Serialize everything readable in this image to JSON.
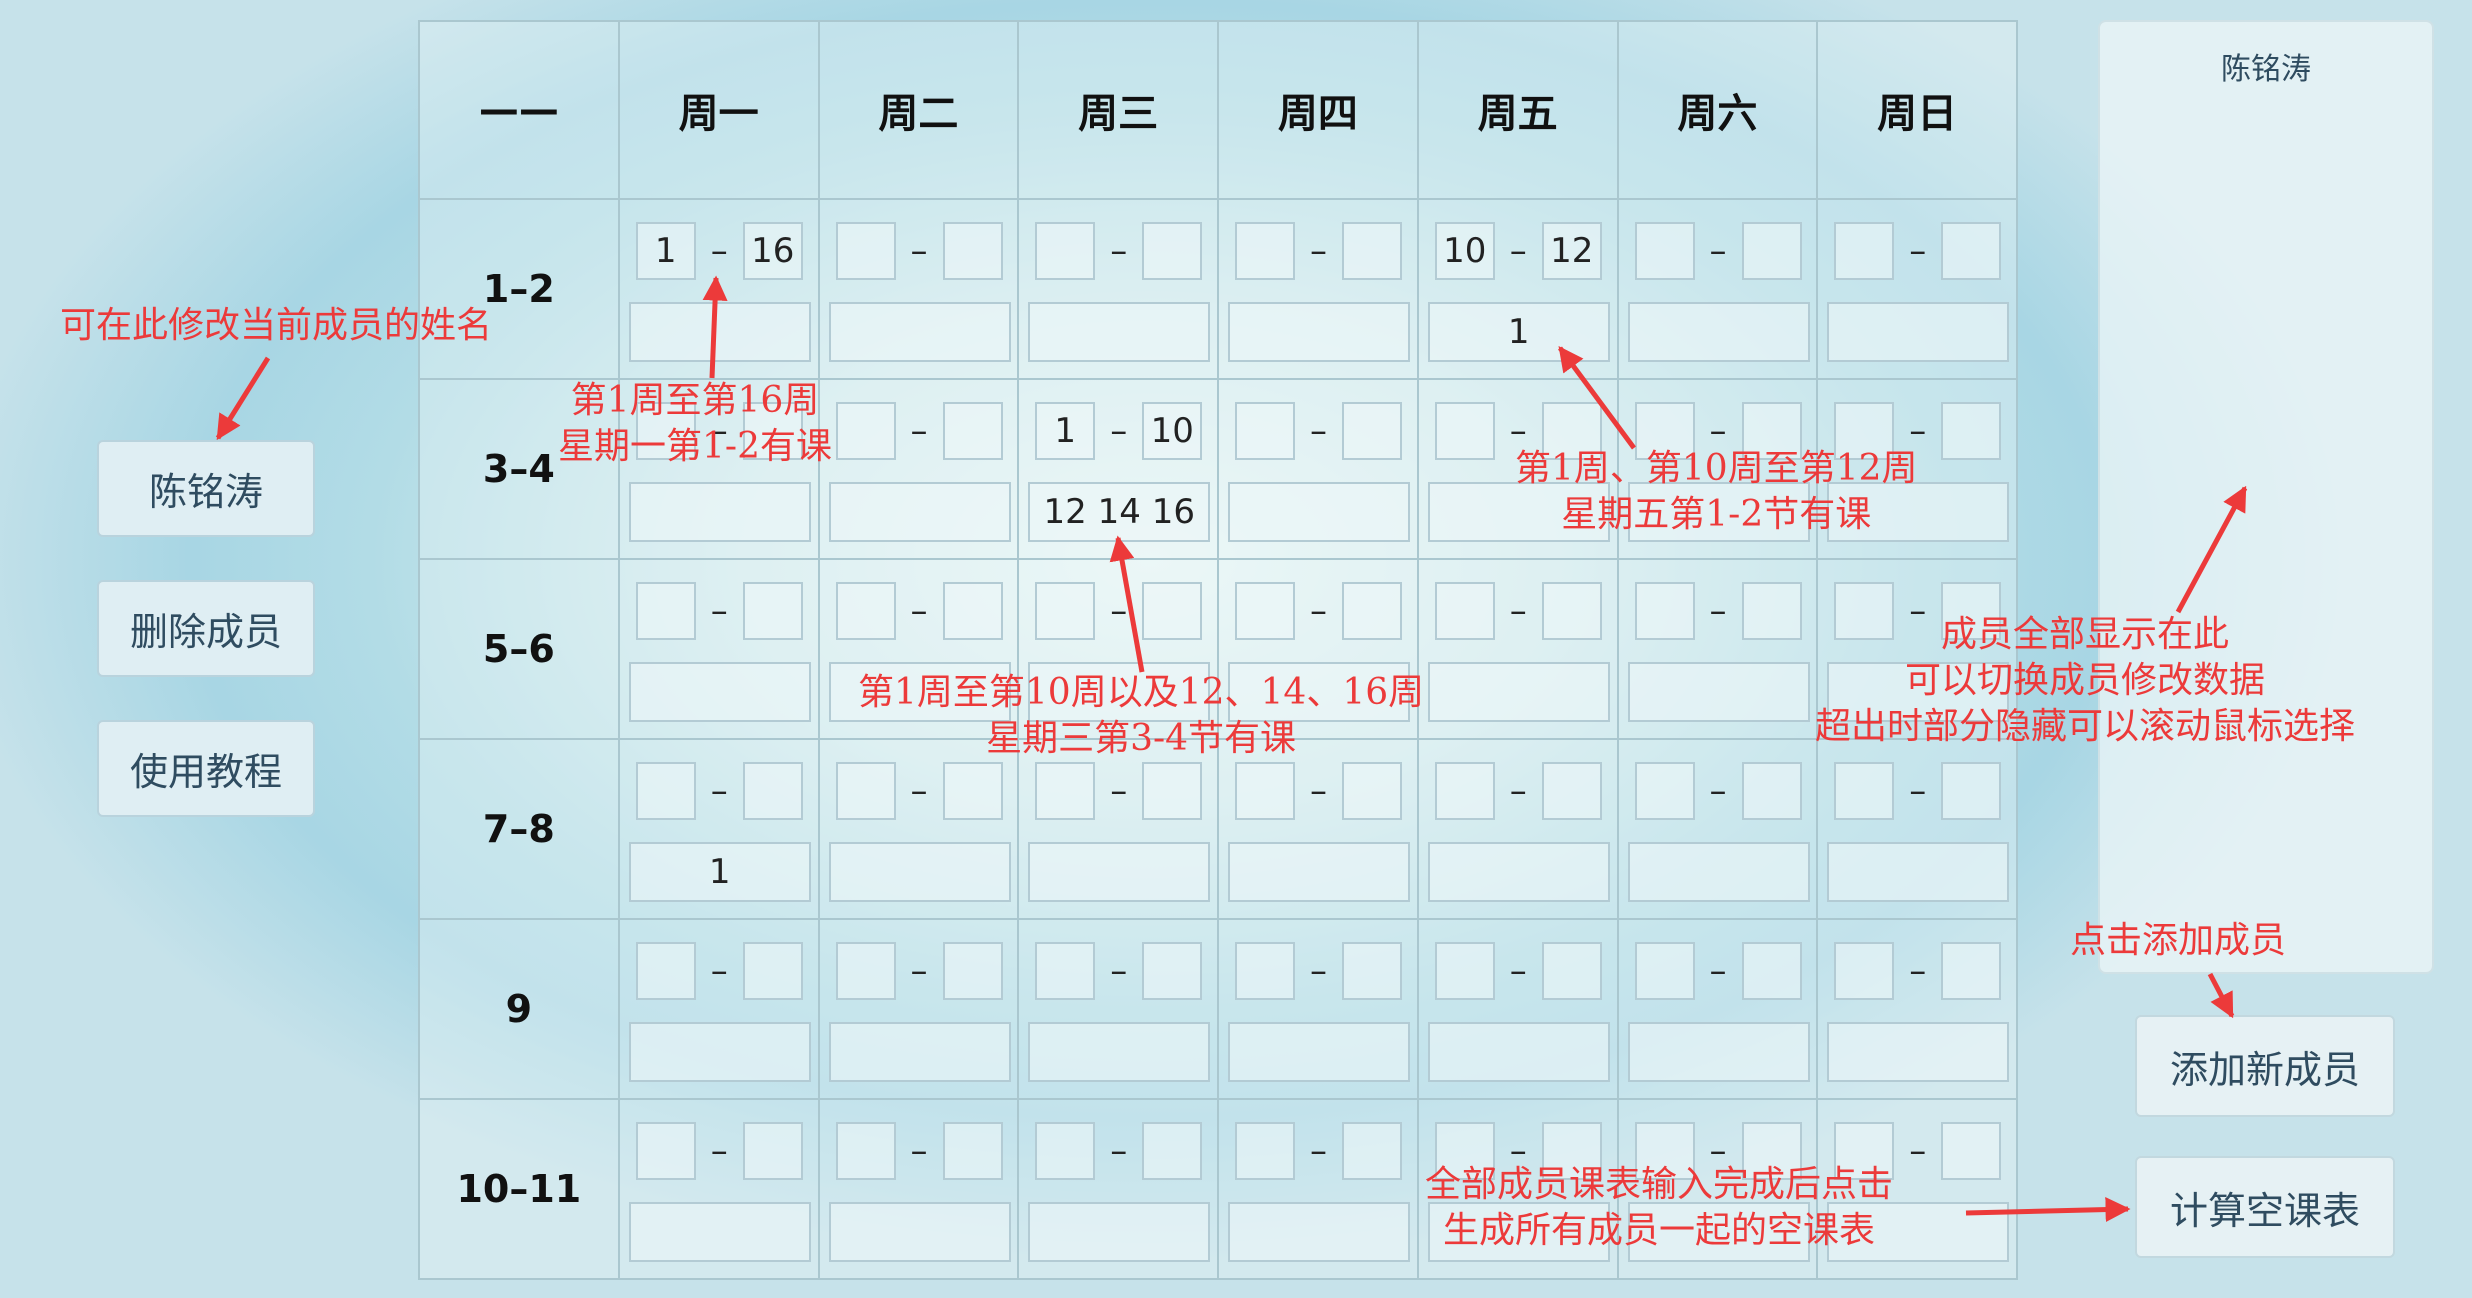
{
  "left_panel": {
    "current_member_name": "陈铭涛",
    "delete_label": "删除成员",
    "tutorial_label": "使用教程"
  },
  "schedule": {
    "corner": "——",
    "days": [
      "周一",
      "周二",
      "周三",
      "周四",
      "周五",
      "周六",
      "周日"
    ],
    "periods": [
      "1–2",
      "3–4",
      "5–6",
      "7–8",
      "9",
      "10–11"
    ],
    "cells": [
      [
        {
          "start": "1",
          "end": "16",
          "special": ""
        },
        {
          "start": "",
          "end": "",
          "special": ""
        },
        {
          "start": "",
          "end": "",
          "special": ""
        },
        {
          "start": "",
          "end": "",
          "special": ""
        },
        {
          "start": "10",
          "end": "12",
          "special": "1"
        },
        {
          "start": "",
          "end": "",
          "special": ""
        },
        {
          "start": "",
          "end": "",
          "special": ""
        }
      ],
      [
        {
          "start": "",
          "end": "",
          "special": ""
        },
        {
          "start": "",
          "end": "",
          "special": ""
        },
        {
          "start": "1",
          "end": "10",
          "special": "12 14 16"
        },
        {
          "start": "",
          "end": "",
          "special": ""
        },
        {
          "start": "",
          "end": "",
          "special": ""
        },
        {
          "start": "",
          "end": "",
          "special": ""
        },
        {
          "start": "",
          "end": "",
          "special": ""
        }
      ],
      [
        {
          "start": "",
          "end": "",
          "special": ""
        },
        {
          "start": "",
          "end": "",
          "special": ""
        },
        {
          "start": "",
          "end": "",
          "special": ""
        },
        {
          "start": "",
          "end": "",
          "special": ""
        },
        {
          "start": "",
          "end": "",
          "special": ""
        },
        {
          "start": "",
          "end": "",
          "special": ""
        },
        {
          "start": "",
          "end": "",
          "special": ""
        }
      ],
      [
        {
          "start": "",
          "end": "",
          "special": "1"
        },
        {
          "start": "",
          "end": "",
          "special": ""
        },
        {
          "start": "",
          "end": "",
          "special": ""
        },
        {
          "start": "",
          "end": "",
          "special": ""
        },
        {
          "start": "",
          "end": "",
          "special": ""
        },
        {
          "start": "",
          "end": "",
          "special": ""
        },
        {
          "start": "",
          "end": "",
          "special": ""
        }
      ],
      [
        {
          "start": "",
          "end": "",
          "special": ""
        },
        {
          "start": "",
          "end": "",
          "special": ""
        },
        {
          "start": "",
          "end": "",
          "special": ""
        },
        {
          "start": "",
          "end": "",
          "special": ""
        },
        {
          "start": "",
          "end": "",
          "special": ""
        },
        {
          "start": "",
          "end": "",
          "special": ""
        },
        {
          "start": "",
          "end": "",
          "special": ""
        }
      ],
      [
        {
          "start": "",
          "end": "",
          "special": ""
        },
        {
          "start": "",
          "end": "",
          "special": ""
        },
        {
          "start": "",
          "end": "",
          "special": ""
        },
        {
          "start": "",
          "end": "",
          "special": ""
        },
        {
          "start": "",
          "end": "",
          "special": ""
        },
        {
          "start": "",
          "end": "",
          "special": ""
        },
        {
          "start": "",
          "end": "",
          "special": ""
        }
      ]
    ],
    "dash": "–"
  },
  "members_panel": {
    "members": [
      "陈铭涛"
    ]
  },
  "right_buttons": {
    "add_member_label": "添加新成员",
    "compute_label": "计算空课表"
  },
  "annotations": {
    "modify_name": "可在此修改当前成员的姓名",
    "mon_note_1": "第1周至第16周",
    "mon_note_2": "星期一第1-2有课",
    "fri_note_1": "第1周、第10周至第12周",
    "fri_note_2": "星期五第1-2节有课",
    "wed_note_1": "第1周至第10周以及12、14、16周",
    "wed_note_2": "星期三第3-4节有课",
    "members_note_1": "成员全部显示在此",
    "members_note_2": "可以切换成员修改数据",
    "members_note_3": "超出时部分隐藏可以滚动鼠标选择",
    "add_note": "点击添加成员",
    "compute_note_1": "全部成员课表输入完成后点击",
    "compute_note_2": "生成所有成员一起的空课表"
  },
  "colors": {
    "annotation": "#ec3a3a",
    "button_text": "#2f4c60",
    "grid_border": "#aac7cf"
  }
}
